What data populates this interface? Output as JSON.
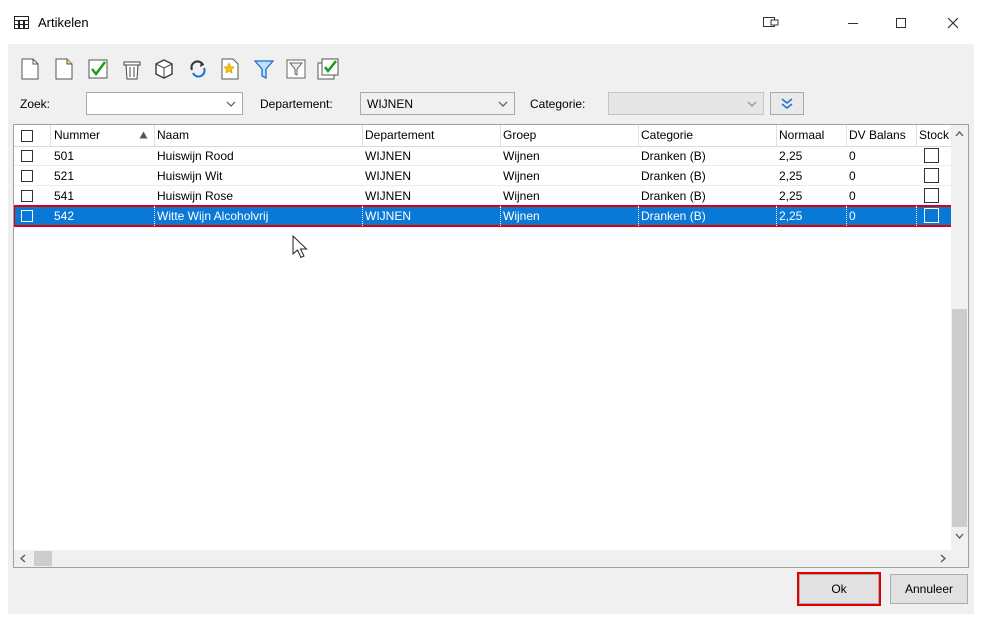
{
  "window": {
    "title": "Artikelen",
    "controls": [
      "restore-icon",
      "minimize-icon",
      "maximize-icon",
      "close-icon"
    ]
  },
  "toolbar": {
    "icons": [
      "new-document-icon",
      "edit-document-icon",
      "check-icon",
      "delete-bin-icon",
      "cube-icon",
      "refresh-icon",
      "favorite-icon",
      "filter-icon",
      "clear-filter-icon",
      "select-all-icon"
    ]
  },
  "filters": {
    "search_label": "Zoek:",
    "search_value": "",
    "department_label": "Departement:",
    "department_value": "WIJNEN",
    "category_label": "Categorie:",
    "category_value": ""
  },
  "table": {
    "columns": [
      "Nummer",
      "Naam",
      "Departement",
      "Groep",
      "Categorie",
      "Normaal",
      "DV Balans",
      "Stock"
    ],
    "sort_column": "Nummer",
    "rows": [
      {
        "nummer": "501",
        "naam": "Huiswijn Rood",
        "departement": "WIJNEN",
        "groep": "Wijnen",
        "categorie": "Dranken (B)",
        "normaal": "2,25",
        "dv_balans": "0",
        "selected": false
      },
      {
        "nummer": "521",
        "naam": "Huiswijn Wit",
        "departement": "WIJNEN",
        "groep": "Wijnen",
        "categorie": "Dranken (B)",
        "normaal": "2,25",
        "dv_balans": "0",
        "selected": false
      },
      {
        "nummer": "541",
        "naam": "Huiswijn Rose",
        "departement": "WIJNEN",
        "groep": "Wijnen",
        "categorie": "Dranken (B)",
        "normaal": "2,25",
        "dv_balans": "0",
        "selected": false
      },
      {
        "nummer": "542",
        "naam": "Witte Wijn Alcoholvrij",
        "departement": "WIJNEN",
        "groep": "Wijnen",
        "categorie": "Dranken (B)",
        "normaal": "2,25",
        "dv_balans": "0",
        "selected": true
      }
    ]
  },
  "buttons": {
    "ok": "Ok",
    "cancel": "Annuleer"
  },
  "colors": {
    "selection": "#0a78d7",
    "highlight": "#e00000"
  }
}
